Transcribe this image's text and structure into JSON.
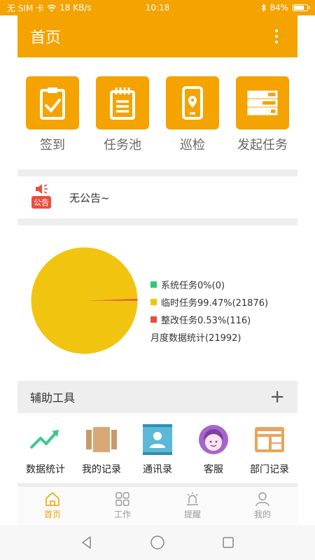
{
  "status": {
    "carrier": "无 SIM 卡",
    "speed": "18 KB/s",
    "time": "10:18",
    "battery": "84%",
    "battery_level": 0.84
  },
  "appbar": {
    "title": "首页"
  },
  "quick_actions": [
    {
      "label": "签到",
      "icon": "clipboard-check-icon"
    },
    {
      "label": "任务池",
      "icon": "notepad-icon"
    },
    {
      "label": "巡检",
      "icon": "phone-location-icon"
    },
    {
      "label": "发起任务",
      "icon": "task-list-icon"
    }
  ],
  "notice": {
    "badge": "公告",
    "text": "无公告~"
  },
  "chart_data": {
    "type": "pie",
    "title": "月度数据统计(21992)",
    "series": [
      {
        "name": "系统任务0%(0)",
        "value": 0,
        "color": "#2ecc71"
      },
      {
        "name": "临时任务99.47%(21876)",
        "value": 21876,
        "color": "#f1c40f"
      },
      {
        "name": "整改任务0.53%(116)",
        "value": 116,
        "color": "#e74c3c"
      }
    ],
    "legend": "right"
  },
  "tools": {
    "title": "辅助工具",
    "plus": "+",
    "items": [
      {
        "label": "数据统计",
        "icon": "trend-chart-icon"
      },
      {
        "label": "我的记录",
        "icon": "records-icon"
      },
      {
        "label": "通讯录",
        "icon": "contacts-icon"
      },
      {
        "label": "客服",
        "icon": "customer-service-icon"
      },
      {
        "label": "部门记录",
        "icon": "department-records-icon"
      }
    ]
  },
  "tabs": [
    {
      "label": "首页",
      "icon": "home-icon"
    },
    {
      "label": "工作",
      "icon": "grid-icon"
    },
    {
      "label": "提醒",
      "icon": "alarm-icon"
    },
    {
      "label": "我的",
      "icon": "person-icon"
    }
  ],
  "colors": {
    "primary": "#f4a300",
    "tab_active": "#f4a300",
    "tab_inactive": "#999999"
  }
}
